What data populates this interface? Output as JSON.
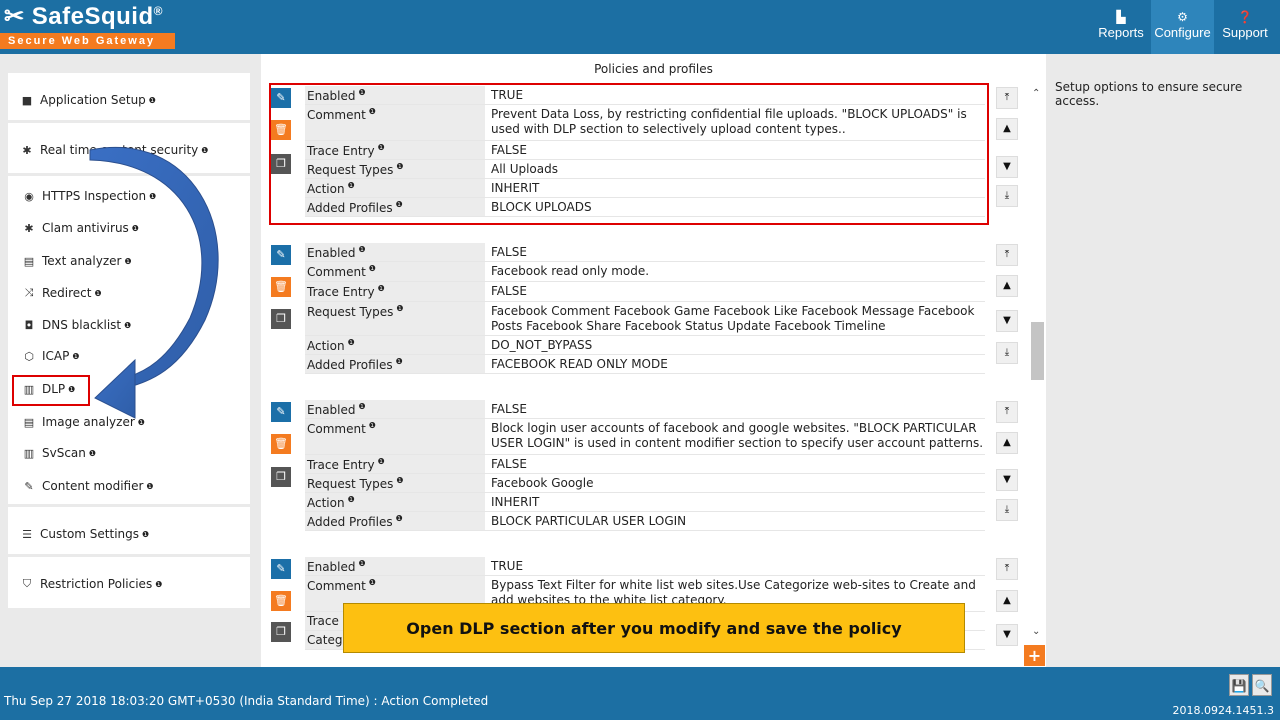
{
  "header": {
    "logo": "SafeSquid",
    "logo_mark": "®",
    "tagline": "Secure Web Gateway",
    "nav": {
      "reports": "Reports",
      "configure": "Configure",
      "support": "Support"
    }
  },
  "sidebar": {
    "application_setup": "Application Setup",
    "realtime_security": "Real time content security",
    "items": [
      "HTTPS Inspection",
      "Clam antivirus",
      "Text analyzer",
      "Redirect",
      "DNS blacklist",
      "ICAP",
      "DLP",
      "Image analyzer",
      "SvScan",
      "Content modifier"
    ],
    "custom_settings": "Custom Settings",
    "restriction_policies": "Restriction Policies",
    "info_mark": "❶"
  },
  "main": {
    "title": "Policies and profiles",
    "field_labels": {
      "enabled": "Enabled",
      "comment": "Comment",
      "trace_entry": "Trace Entry",
      "request_types": "Request Types",
      "action": "Action",
      "added_profiles": "Added Profiles",
      "trace_entry_cut": "Trace E",
      "request_types_cut": "Catego"
    },
    "policies": [
      {
        "enabled": "TRUE",
        "comment": "Prevent Data Loss, by restricting confidential file uploads. \"BLOCK UPLOADS\" is used with DLP section to selectively  upload content types..",
        "trace_entry": "FALSE",
        "request_types": "All Uploads",
        "action": "INHERIT",
        "added_profiles": "BLOCK UPLOADS"
      },
      {
        "enabled": "FALSE",
        "comment": "Facebook read only mode.",
        "trace_entry": "FALSE",
        "request_types": "Facebook Comment  Facebook Game  Facebook Like  Facebook Message  Facebook Posts  Facebook Share  Facebook Status Update  Facebook Timeline",
        "action": "DO_NOT_BYPASS",
        "added_profiles": "FACEBOOK READ ONLY MODE"
      },
      {
        "enabled": "FALSE",
        "comment": "Block login user accounts of facebook and google websites. \"BLOCK PARTICULAR USER LOGIN\" is used in content modifier section to specify user account patterns.",
        "trace_entry": "FALSE",
        "request_types": "Facebook  Google",
        "action": "INHERIT",
        "added_profiles": "BLOCK PARTICULAR USER LOGIN"
      },
      {
        "enabled": "TRUE",
        "comment": "Bypass Text Filter for white list web sites.Use Categorize web-sites to Create and add websites to the white list category."
      }
    ]
  },
  "right_info": "Setup options to ensure secure access.",
  "callout": "Open DLP section after you modify and save the policy",
  "footer": {
    "status": "Thu Sep 27 2018 18:03:20 GMT+0530 (India Standard Time) : Action Completed",
    "version": "2018.0924.1451.3"
  },
  "icons": [
    "edit-icon",
    "delete-icon",
    "copy-icon",
    "arrow-top-icon",
    "arrow-up-icon",
    "arrow-down-icon",
    "arrow-bottom-icon",
    "save-icon",
    "search-icon",
    "plus-icon"
  ],
  "colors": {
    "brand_blue": "#1c6fa3",
    "accent_orange": "#f47b20",
    "callout_yellow": "#fdc011",
    "highlight_red": "#dd0000"
  }
}
